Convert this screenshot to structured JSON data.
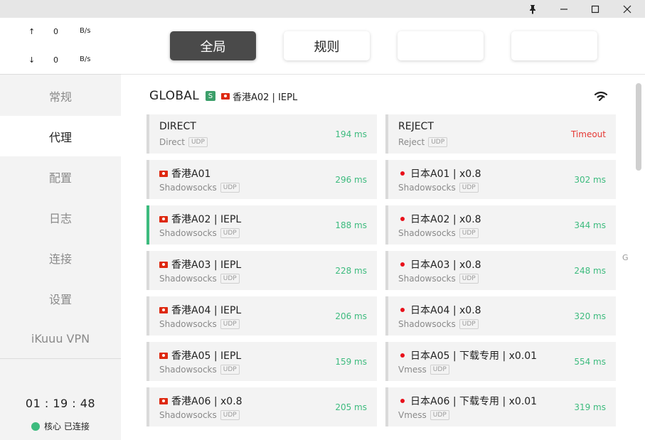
{
  "window": {
    "pin_icon": "pin-icon",
    "minimize_icon": "minimize-icon",
    "maximize_icon": "maximize-icon",
    "close_icon": "close-icon"
  },
  "traffic": {
    "upload_arrow": "↑",
    "upload_value": "0",
    "upload_unit": "B/s",
    "download_arrow": "↓",
    "download_value": "0",
    "download_unit": "B/s"
  },
  "nav": {
    "general": "常规",
    "proxy": "代理",
    "profile": "配置",
    "logs": "日志",
    "connections": "连接",
    "settings": "设置",
    "vpn": "iKuuu VPN"
  },
  "footer": {
    "uptime": "01 : 19 : 48",
    "status_text": "核心 已连接"
  },
  "modes": {
    "global": "全局",
    "rule": "规则",
    "direct": "",
    "script": ""
  },
  "group": {
    "title": "GLOBAL",
    "badge": "S",
    "selected": "香港A02 | IEPL"
  },
  "side_letter": "G",
  "colors": {
    "accent": "#3dbb7e",
    "timeout": "#e53935",
    "active_mode": "#4a4a4a"
  },
  "proxies": [
    {
      "name": "DIRECT",
      "type": "Direct",
      "udp": "UDP",
      "delay": "194 ms",
      "flag": "none"
    },
    {
      "name": "REJECT",
      "type": "Reject",
      "udp": "UDP",
      "delay": "Timeout",
      "flag": "none"
    },
    {
      "name": "香港A01",
      "type": "Shadowsocks",
      "udp": "UDP",
      "delay": "296 ms",
      "flag": "hk"
    },
    {
      "name": "日本A01 | x0.8",
      "type": "Shadowsocks",
      "udp": "UDP",
      "delay": "302 ms",
      "flag": "jp"
    },
    {
      "name": "香港A02 | IEPL",
      "type": "Shadowsocks",
      "udp": "UDP",
      "delay": "188 ms",
      "flag": "hk"
    },
    {
      "name": "日本A02 | x0.8",
      "type": "Shadowsocks",
      "udp": "UDP",
      "delay": "344 ms",
      "flag": "jp"
    },
    {
      "name": "香港A03 | IEPL",
      "type": "Shadowsocks",
      "udp": "UDP",
      "delay": "228 ms",
      "flag": "hk"
    },
    {
      "name": "日本A03 | x0.8",
      "type": "Shadowsocks",
      "udp": "UDP",
      "delay": "248 ms",
      "flag": "jp"
    },
    {
      "name": "香港A04 | IEPL",
      "type": "Shadowsocks",
      "udp": "UDP",
      "delay": "206 ms",
      "flag": "hk"
    },
    {
      "name": "日本A04 | x0.8",
      "type": "Shadowsocks",
      "udp": "UDP",
      "delay": "320 ms",
      "flag": "jp"
    },
    {
      "name": "香港A05 | IEPL",
      "type": "Shadowsocks",
      "udp": "UDP",
      "delay": "159 ms",
      "flag": "hk"
    },
    {
      "name": "日本A05 | 下载专用 | x0.01",
      "type": "Vmess",
      "udp": "UDP",
      "delay": "554 ms",
      "flag": "jp"
    },
    {
      "name": "香港A06 | x0.8",
      "type": "Shadowsocks",
      "udp": "UDP",
      "delay": "205 ms",
      "flag": "hk"
    },
    {
      "name": "日本A06 | 下载专用 | x0.01",
      "type": "Vmess",
      "udp": "UDP",
      "delay": "319 ms",
      "flag": "jp"
    }
  ]
}
